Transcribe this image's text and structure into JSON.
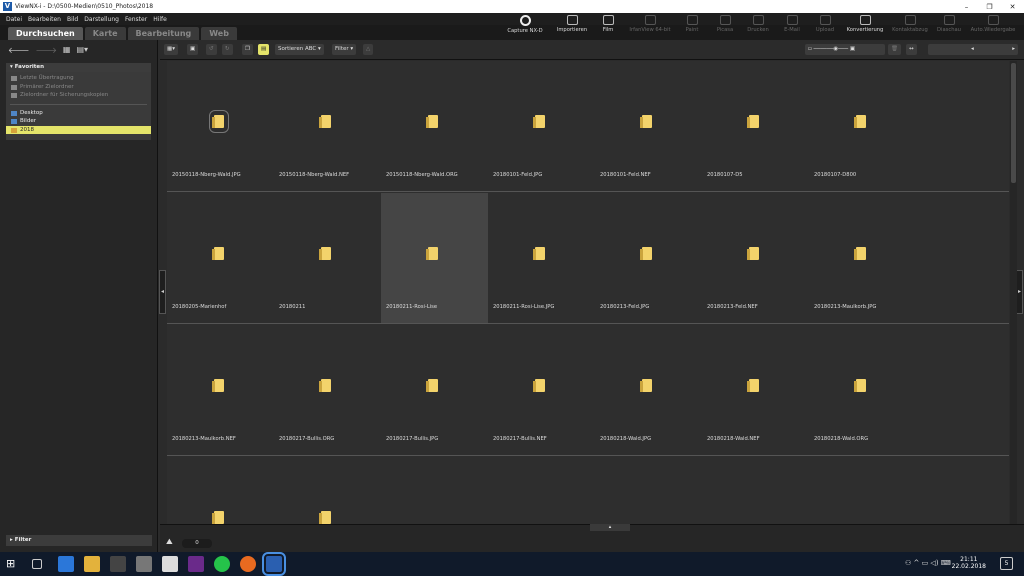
{
  "window": {
    "title": "ViewNX-i - D:\\0500-Medien\\0510_Photos\\2018"
  },
  "menu": [
    "Datei",
    "Bearbeiten",
    "Bild",
    "Darstellung",
    "Fenster",
    "Hilfe"
  ],
  "tabs": [
    "Durchsuchen",
    "Karte",
    "Bearbeitung",
    "Web"
  ],
  "tools": [
    "Capture NX-D",
    "Importieren",
    "Film",
    "IrfanView 64-bit",
    "Paint",
    "Picasa",
    "Drucken",
    "E-Mail",
    "Upload",
    "Konvertierung",
    "Kontaktabzug",
    "Diaschau",
    "Auto.Wiedergabe"
  ],
  "favorites": {
    "header": "Favoriten",
    "items": [
      "Letzte Übertragung",
      "Primärer Zielordner",
      "Zielordner für Sicherungskopien"
    ],
    "locations": [
      "Desktop",
      "Bilder",
      "2018"
    ]
  },
  "filter_label": "Filter",
  "toolbar": {
    "sort_label": "Sortieren",
    "sort_value": "ABC",
    "filter_label": "Filter"
  },
  "files": [
    "20150118-Nberg-Wald.JPG",
    "20150118-Nberg-Wald.NEF",
    "20150118-Nberg-Wald.ORG",
    "20180101-Feld.JPG",
    "20180101-Feld.NEF",
    "20180107-D5",
    "20180107-D800",
    "20180205-Marienhof",
    "20180211",
    "20180211-Rosi-Lise",
    "20180211-Rosi-Lise.JPG",
    "20180213-Feld.JPG",
    "20180213-Feld.NEF",
    "20180213-Maulkorb.JPG",
    "20180213-Maulkorb.NEF",
    "20180217-Bullis.ORG",
    "20180217-Bullis.JPG",
    "20180217-Bullis.NEF",
    "20180218-Wald.JPG",
    "20180218-Wald.NEF",
    "20180218-Wald.ORG",
    "",
    ""
  ],
  "status": {
    "count": "0"
  },
  "clock": {
    "time": "21:11",
    "date": "22.02.2018",
    "notifications": "5"
  }
}
